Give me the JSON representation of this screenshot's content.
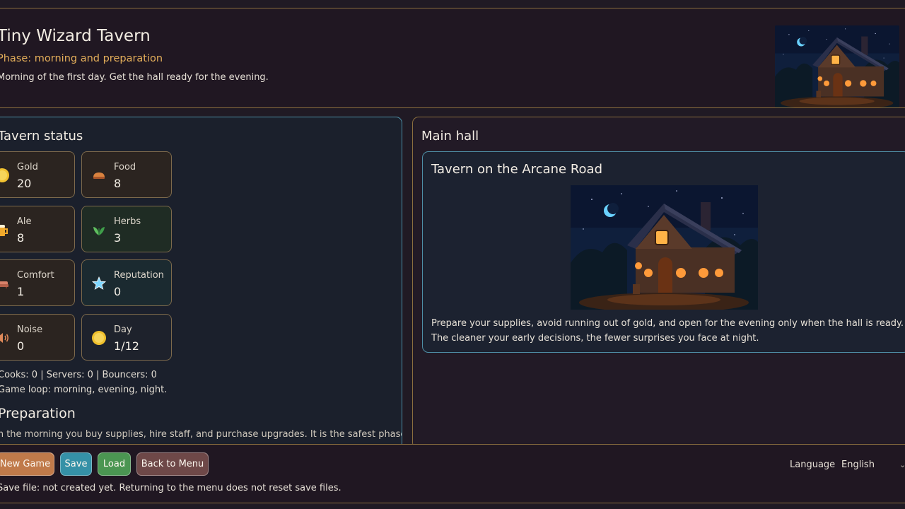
{
  "header": {
    "title": "Tiny Wizard Tavern",
    "phase": "Phase: morning and preparation",
    "description": "Morning of the first day. Get the hall ready for the evening."
  },
  "status": {
    "title": "Tavern status",
    "resources": [
      {
        "label": "Gold",
        "value": "20",
        "icon": "coin-icon"
      },
      {
        "label": "Food",
        "value": "8",
        "icon": "bread-icon"
      },
      {
        "label": "Ale",
        "value": "8",
        "icon": "beer-mug-icon"
      },
      {
        "label": "Herbs",
        "value": "3",
        "icon": "herb-leaf-icon"
      },
      {
        "label": "Comfort",
        "value": "1",
        "icon": "sofa-icon"
      },
      {
        "label": "Reputation",
        "value": "0",
        "icon": "star-icon"
      },
      {
        "label": "Noise",
        "value": "0",
        "icon": "speaker-icon"
      },
      {
        "label": "Day",
        "value": "1/12",
        "icon": "sun-icon"
      }
    ],
    "staff": "Cooks: 0 | Servers: 0 | Bouncers: 0",
    "loop": "Game loop: morning, evening, night."
  },
  "preparation": {
    "title": "Preparation",
    "text": "In the morning you buy supplies, hire staff, and purchase upgrades. It is the safest phase."
  },
  "main_hall": {
    "title": "Main hall",
    "card_title": "Tavern on the Arcane Road",
    "lines": [
      "Prepare your supplies, avoid running out of gold, and open for the evening only when the hall is ready.",
      "The cleaner your early decisions, the fewer surprises you face at night."
    ]
  },
  "footer": {
    "buttons": {
      "new_game": "New Game",
      "save": "Save",
      "load": "Load",
      "back": "Back to Menu"
    },
    "save_status": "Save file: not created yet. Returning to the menu does not reset save files.",
    "language_label": "Language",
    "language_value": "English"
  },
  "colors": {
    "accent_gold": "#e3ae5a",
    "panel_border_teal": "#4e8fa6",
    "panel_border_bronze": "#8a6e3e"
  }
}
